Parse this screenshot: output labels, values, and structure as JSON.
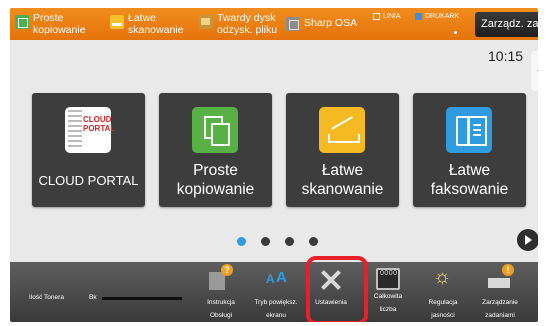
{
  "topbar": {
    "shortcuts": [
      {
        "label": "Proste\nkopiowanie",
        "icon": "copy-icon"
      },
      {
        "label": "Łatwe\nskanowanie",
        "icon": "scan-icon"
      },
      {
        "label": "Twardy dysk\nodzysk. pliku",
        "icon": "hard-disk-icon"
      },
      {
        "label": "Sharp OSA",
        "icon": "osa-icon"
      }
    ],
    "status_line": "LINIA",
    "status_printer": "DRUKARK",
    "jobs_button": "Zarządz. zadan."
  },
  "clock": "10:15",
  "tiles": [
    {
      "label": "CLOUD PORTAL",
      "icon": "cloud-portal-icon",
      "logo_text": "CLOUD\nPORTAL"
    },
    {
      "label": "Proste\nkopiowanie",
      "icon": "copy-icon"
    },
    {
      "label": "Łatwe\nskanowanie",
      "icon": "scan-icon"
    },
    {
      "label": "Łatwe\nfaksowanie",
      "icon": "fax-icon"
    }
  ],
  "pager": {
    "pages": 4,
    "current": 1
  },
  "tray": {
    "toner_label": "Ilość Tonera",
    "toner_color": "Bk",
    "toner_level": 1.0,
    "items": [
      {
        "label": "Instrukcja\nObsługi",
        "icon": "manual-icon"
      },
      {
        "label": "Tryb powiększ.\nekranu",
        "icon": "zoom-text-icon"
      },
      {
        "label": "Ustawienia",
        "icon": "settings-icon"
      },
      {
        "label": "Całkowita\nliczba",
        "icon": "counter-icon"
      },
      {
        "label": "Regulacja\njasności",
        "icon": "brightness-icon"
      },
      {
        "label": "Zarządzanie\nzadaniami",
        "icon": "job-status-icon"
      }
    ],
    "highlighted_item": "Ustawienia"
  },
  "colors": {
    "topbar": "#e5730c",
    "accent_blue": "#2f9ce0",
    "highlight_red": "#e8202a",
    "tile_bg": "#3d3d3d"
  }
}
